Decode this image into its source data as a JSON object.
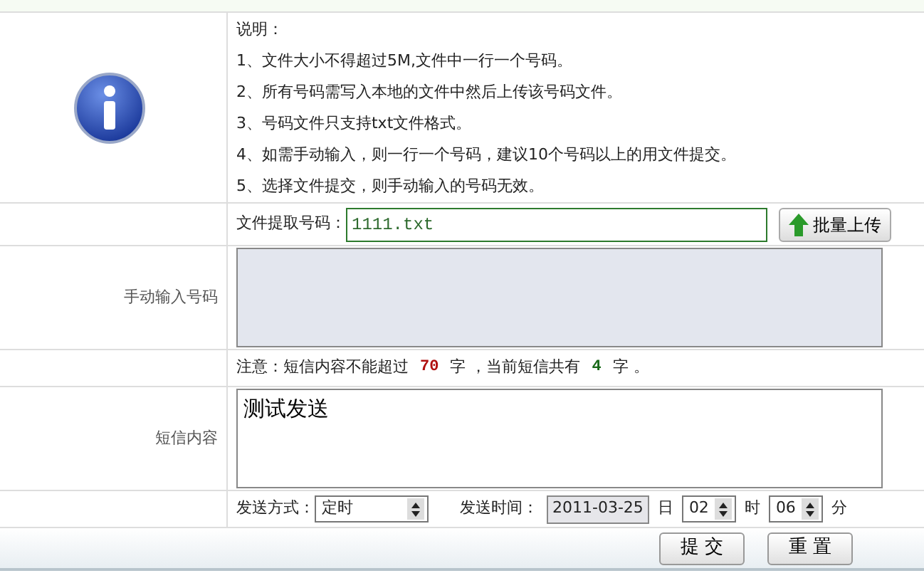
{
  "instructions": {
    "title": "说明：",
    "items": [
      "1、文件大小不得超过5M,文件中一行一个号码。",
      "2、所有号码需写入本地的文件中然后上传该号码文件。",
      "3、号码文件只支持txt文件格式。",
      "4、如需手动输入，则一行一个号码，建议10个号码以上的用文件提交。",
      "5、选择文件提交，则手动输入的号码无效。"
    ]
  },
  "file_row": {
    "label": "文件提取号码：",
    "value": "1111.txt",
    "button": "批量上传"
  },
  "manual_input": {
    "label": "手动输入号码",
    "disabled": true
  },
  "notice": {
    "prefix": "注意：短信内容不能超过",
    "limit": "70",
    "middle": "字 ，当前短信共有",
    "count": "4",
    "suffix": "字 。"
  },
  "sms": {
    "label": "短信内容",
    "value": "测试发送"
  },
  "send": {
    "mode_label": "发送方式：",
    "mode": "定时",
    "time_label": "发送时间：",
    "date": "2011-03-25",
    "day_unit": "日",
    "hour": "02",
    "hour_unit": "时",
    "minute": "06",
    "minute_unit": "分"
  },
  "buttons": [
    "提 交",
    "重 置"
  ]
}
